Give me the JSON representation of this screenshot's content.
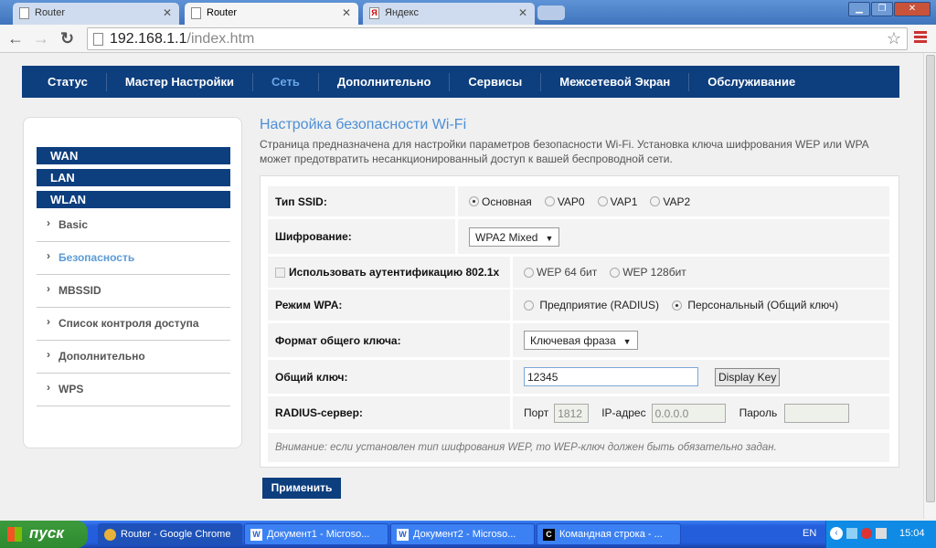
{
  "browser": {
    "tabs": [
      {
        "title": "Router",
        "active": false
      },
      {
        "title": "Router",
        "active": true
      },
      {
        "title": "Яндекс",
        "active": false
      }
    ],
    "url_host": "192.168.1.1",
    "url_path": "/index.htm"
  },
  "nav": {
    "items": [
      "Статус",
      "Мастер Настройки",
      "Сеть",
      "Дополнительно",
      "Сервисы",
      "Межсетевой Экран",
      "Обслуживание"
    ],
    "current": "Сеть"
  },
  "sidebar": {
    "sections": [
      "WAN",
      "LAN",
      "WLAN"
    ],
    "items": [
      "Basic",
      "Безопасность",
      "MBSSID",
      "Список контроля доступа",
      "Дополнительно",
      "WPS"
    ],
    "current": "Безопасность"
  },
  "main": {
    "title": "Настройка безопасности Wi-Fi",
    "description": "Страница предназначена для настройки параметров безопасности Wi-Fi. Установка ключа шифрования WEP или WPA может предотвратить несанкционированный доступ к вашей беспроводной сети.",
    "ssid_label": "Тип SSID:",
    "ssid_options": [
      "Основная",
      "VAP0",
      "VAP1",
      "VAP2"
    ],
    "ssid_selected": "Основная",
    "enc_label": "Шифрование:",
    "enc_value": "WPA2 Mixed",
    "auth_label": "Использовать аутентификацию 802.1x",
    "auth_checked": false,
    "wep_options": [
      "WEP 64 бит",
      "WEP 128бит"
    ],
    "wpa_label": "Режим WPA:",
    "wpa_options": [
      "Предприятие (RADIUS)",
      "Персональный (Общий ключ)"
    ],
    "wpa_selected": "Персональный (Общий ключ)",
    "format_label": "Формат общего ключа:",
    "format_value": "Ключевая фраза",
    "key_label": "Общий ключ:",
    "key_value": "12345",
    "display_key": "Display Key",
    "radius_label": "RADIUS-сервер:",
    "port_label": "Порт",
    "port_value": "1812",
    "ip_label": "IP-адрес",
    "ip_value": "0.0.0.0",
    "pass_label": "Пароль",
    "pass_value": "",
    "note": "Внимание: если установлен тип шифрования WEP, то WEP-ключ должен быть обязательно задан.",
    "apply": "Применить"
  },
  "taskbar": {
    "start": "пуск",
    "tasks": [
      "Router - Google Chrome",
      "Документ1 - Microso...",
      "Документ2 - Microso...",
      "Командная строка - ..."
    ],
    "lang": "EN",
    "clock": "15:04"
  }
}
